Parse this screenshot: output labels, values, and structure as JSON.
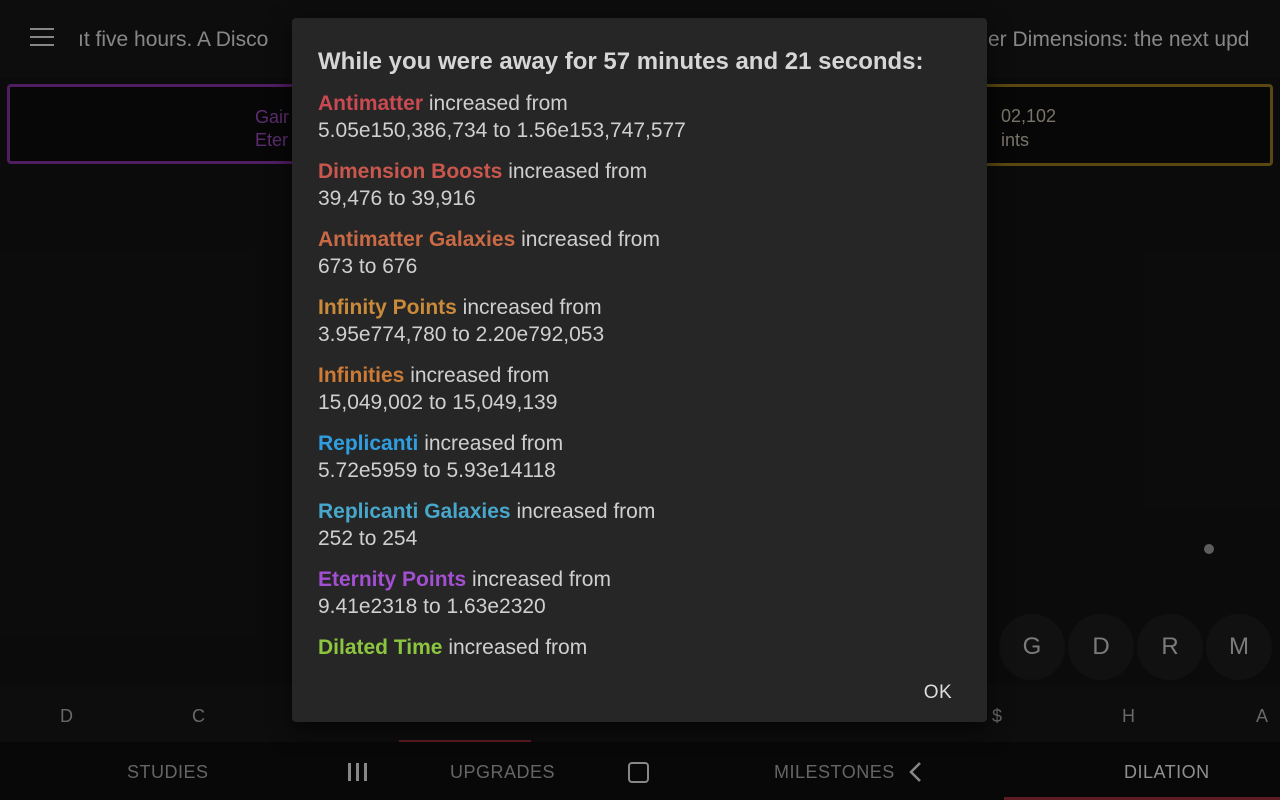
{
  "header": {
    "news_left": "ıt five hours. A Disco",
    "news_right": "er Dimensions: the next upd"
  },
  "gain_button": {
    "line1": "Gair",
    "line2": "Eter"
  },
  "right_button": {
    "line1": "02,102",
    "line2": "ints"
  },
  "circle_buttons": [
    "G",
    "D",
    "R",
    "M"
  ],
  "subtabs": [
    "D",
    "C",
    "$",
    "H",
    "A"
  ],
  "nav": {
    "studies": "STUDIES",
    "upgrades": "UPGRADES",
    "milestones": "MILESTONES",
    "dilation": "DILATION"
  },
  "modal": {
    "title": "While you were away for 57 minutes and 21 seconds:",
    "verb": "increased from",
    "items": [
      {
        "name": "Antimatter",
        "color": "#c94a52",
        "from": "5.05e150,386,734",
        "to": "1.56e153,747,577"
      },
      {
        "name": "Dimension Boosts",
        "color": "#c9574d",
        "from": "39,476",
        "to": "39,916"
      },
      {
        "name": "Antimatter Galaxies",
        "color": "#c96a45",
        "from": "673",
        "to": "676"
      },
      {
        "name": "Infinity Points",
        "color": "#c98a3a",
        "from": "3.95e774,780",
        "to": "2.20e792,053"
      },
      {
        "name": "Infinities",
        "color": "#cc7a36",
        "from": "15,049,002",
        "to": "15,049,139"
      },
      {
        "name": "Replicanti",
        "color": "#2f9ee0",
        "from": "5.72e5959",
        "to": "5.93e14118"
      },
      {
        "name": "Replicanti Galaxies",
        "color": "#47a8cc",
        "from": "252",
        "to": "254"
      },
      {
        "name": "Eternity Points",
        "color": "#a34fd1",
        "from": "9.41e2318",
        "to": "1.63e2320"
      },
      {
        "name": "Dilated Time",
        "color": "#8cc63f",
        "from": "",
        "to": ""
      }
    ],
    "ok_label": "OK"
  },
  "colors": {
    "eternity_border": "#7b2f94",
    "infinity_border": "#8a6d1c",
    "active_tab_underline": "#8e2a3a"
  }
}
